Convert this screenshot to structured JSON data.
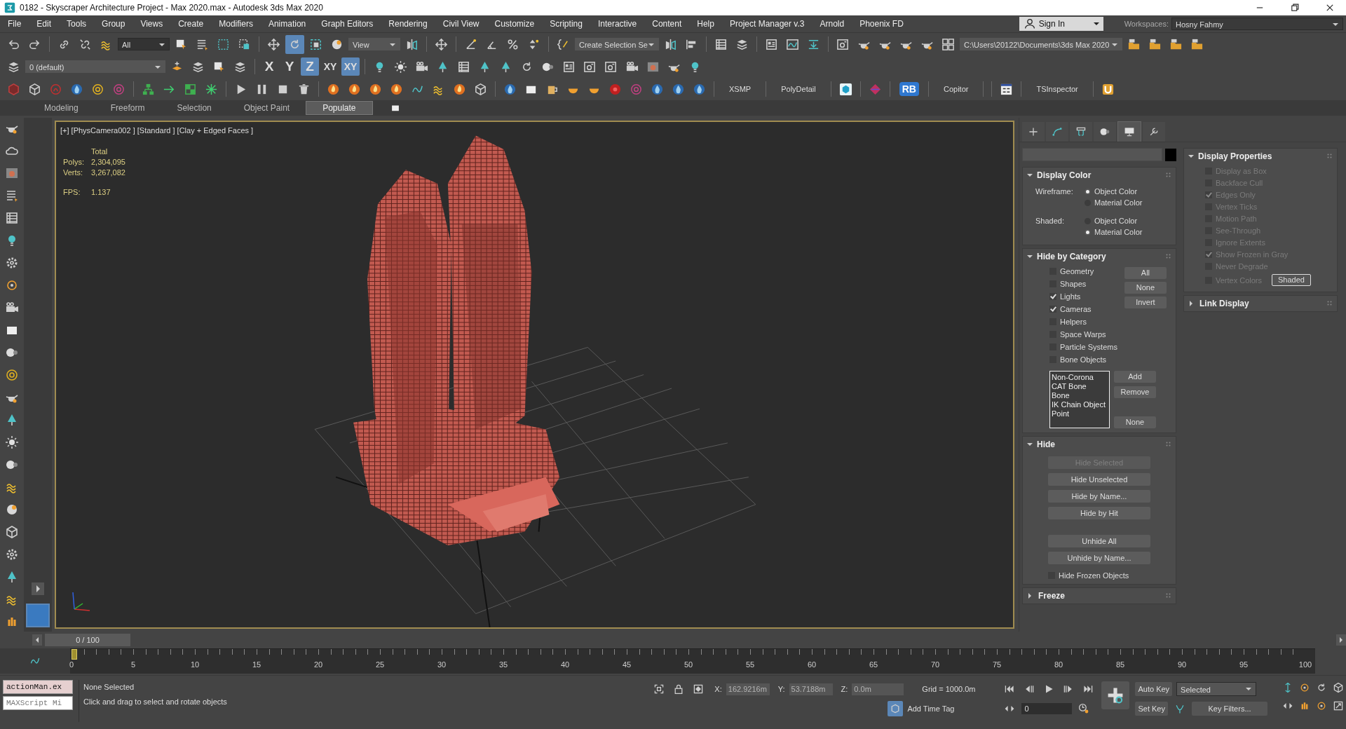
{
  "window": {
    "title": "0182 - Skyscraper Architecture Project - Max 2020.max - Autodesk 3ds Max 2020"
  },
  "menu": [
    "File",
    "Edit",
    "Tools",
    "Group",
    "Views",
    "Create",
    "Modifiers",
    "Animation",
    "Graph Editors",
    "Rendering",
    "Civil View",
    "Customize",
    "Scripting",
    "Interactive",
    "Content",
    "Help",
    "Project Manager v.3",
    "Arnold",
    "Phoenix FD"
  ],
  "sign_in": {
    "label": "Sign In"
  },
  "workspaces": {
    "label": "Workspaces:",
    "value": "Hosny Fahmy"
  },
  "main_toolbar": {
    "selection_filter": "All",
    "reference_coord": "View",
    "named_selection": "Create Selection Se",
    "project_path": "C:\\Users\\20122\\Documents\\3ds Max 2020",
    "transform_tools": [
      {
        "selected": false
      },
      {
        "selected": true
      },
      {
        "selected": false
      }
    ]
  },
  "layer_toolbar": {
    "layer": "0 (default)",
    "axis_buttons": [
      {
        "label": "X",
        "selected": false
      },
      {
        "label": "Y",
        "selected": false
      },
      {
        "label": "Z",
        "selected": true
      },
      {
        "label": "XY",
        "selected": false
      },
      {
        "label": "XY",
        "selected": true
      }
    ]
  },
  "plugin_toolbar": [
    {
      "kind": "text",
      "label": "XSMP"
    },
    {
      "kind": "text",
      "label": "PolyDetail"
    },
    {
      "kind": "badge",
      "label": "RB"
    },
    {
      "kind": "text",
      "label": "Copitor"
    },
    {
      "kind": "text",
      "label": "TSInspector"
    }
  ],
  "ribbon_tabs": [
    {
      "label": "Modeling",
      "selected": false
    },
    {
      "label": "Freeform",
      "selected": false
    },
    {
      "label": "Selection",
      "selected": false
    },
    {
      "label": "Object Paint",
      "selected": false
    },
    {
      "label": "Populate",
      "selected": true
    }
  ],
  "viewport": {
    "label": "[+] [PhysCamera002 ] [Standard ] [Clay + Edged Faces ]",
    "stats_heading": "Total",
    "stats": [
      {
        "label": "Polys:",
        "value": "2,304,095"
      },
      {
        "label": "Verts:",
        "value": "3,267,082"
      },
      {
        "label": "FPS:",
        "value": "1.137"
      }
    ]
  },
  "command_panel": {
    "tabs": [
      {
        "selected": false
      },
      {
        "selected": false
      },
      {
        "selected": false
      },
      {
        "selected": false
      },
      {
        "selected": true
      },
      {
        "selected": false
      }
    ],
    "left_rollouts": [
      {
        "kind": "display_color",
        "title": "Display Color",
        "expanded": true,
        "groups": [
          {
            "label": "Wireframe:",
            "options": [
              {
                "label": "Object Color",
                "selected": true
              },
              {
                "label": "Material Color",
                "selected": false
              }
            ]
          },
          {
            "label": "Shaded:",
            "options": [
              {
                "label": "Object Color",
                "selected": false
              },
              {
                "label": "Material Color",
                "selected": true
              }
            ]
          }
        ]
      },
      {
        "kind": "hide_by_category",
        "title": "Hide by Category",
        "expanded": true,
        "categories": [
          {
            "label": "Geometry",
            "checked": false
          },
          {
            "label": "Shapes",
            "checked": false
          },
          {
            "label": "Lights",
            "checked": true
          },
          {
            "label": "Cameras",
            "checked": true
          },
          {
            "label": "Helpers",
            "checked": false
          },
          {
            "label": "Space Warps",
            "checked": false
          },
          {
            "label": "Particle Systems",
            "checked": false
          },
          {
            "label": "Bone Objects",
            "checked": false
          }
        ],
        "buttons": [
          "All",
          "None",
          "Invert"
        ],
        "list": [
          "Non-Corona",
          "CAT Bone",
          "Bone",
          "IK Chain Object",
          "Point"
        ],
        "list_buttons": [
          "Add",
          "Remove",
          "None"
        ]
      },
      {
        "kind": "buttons",
        "title": "Hide",
        "expanded": true,
        "button_groups": [
          [
            {
              "label": "Hide Selected",
              "disabled": true
            },
            {
              "label": "Hide Unselected",
              "disabled": false
            },
            {
              "label": "Hide by Name...",
              "disabled": false
            },
            {
              "label": "Hide by Hit",
              "disabled": false
            }
          ],
          [
            {
              "label": "Unhide All",
              "disabled": false
            },
            {
              "label": "Unhide by Name...",
              "disabled": false
            }
          ]
        ],
        "checkbox": {
          "label": "Hide Frozen Objects",
          "checked": false
        }
      },
      {
        "kind": "buttons",
        "title": "Freeze",
        "expanded": false
      }
    ],
    "right_rollouts": [
      {
        "kind": "checklist",
        "title": "Display Properties",
        "expanded": true,
        "items": [
          {
            "label": "Display as Box",
            "checked": false,
            "disabled": true
          },
          {
            "label": "Backface Cull",
            "checked": false,
            "disabled": true
          },
          {
            "label": "Edges Only",
            "checked": true,
            "disabled": true
          },
          {
            "label": "Vertex Ticks",
            "checked": false,
            "disabled": true
          },
          {
            "label": "Motion Path",
            "checked": false,
            "disabled": true
          },
          {
            "label": "See-Through",
            "checked": false,
            "disabled": true
          },
          {
            "label": "Ignore Extents",
            "checked": false,
            "disabled": true
          },
          {
            "label": "Show Frozen in Gray",
            "checked": true,
            "disabled": true
          },
          {
            "label": "Never Degrade",
            "checked": false,
            "disabled": true
          },
          {
            "label": "Vertex Colors",
            "checked": false,
            "disabled": true
          }
        ],
        "button": "Shaded"
      },
      {
        "kind": "checklist",
        "title": "Link Display",
        "expanded": false
      }
    ]
  },
  "timeline": {
    "slider": {
      "label": "0 / 100",
      "level": 0
    },
    "ticks": [
      "0",
      "5",
      "10",
      "15",
      "20",
      "25",
      "30",
      "35",
      "40",
      "45",
      "50",
      "55",
      "60",
      "65",
      "70",
      "75",
      "80",
      "85",
      "90",
      "95",
      "100"
    ]
  },
  "status": {
    "listener": [
      "actionMan.ex",
      "MAXScript Mi"
    ],
    "selection": "None Selected",
    "prompt": "Click and drag to select and rotate objects",
    "coords": [
      {
        "label": "X:",
        "value": "162.9216m"
      },
      {
        "label": "Y:",
        "value": "53.7188m"
      },
      {
        "label": "Z:",
        "value": "0.0m"
      }
    ],
    "grid": "Grid = 1000.0m",
    "add_time_tag": "Add Time Tag",
    "frame": "0",
    "auto_key": "Auto Key",
    "set_key": "Set Key",
    "key_mode": "Selected",
    "key_filters": "Key Filters..."
  }
}
